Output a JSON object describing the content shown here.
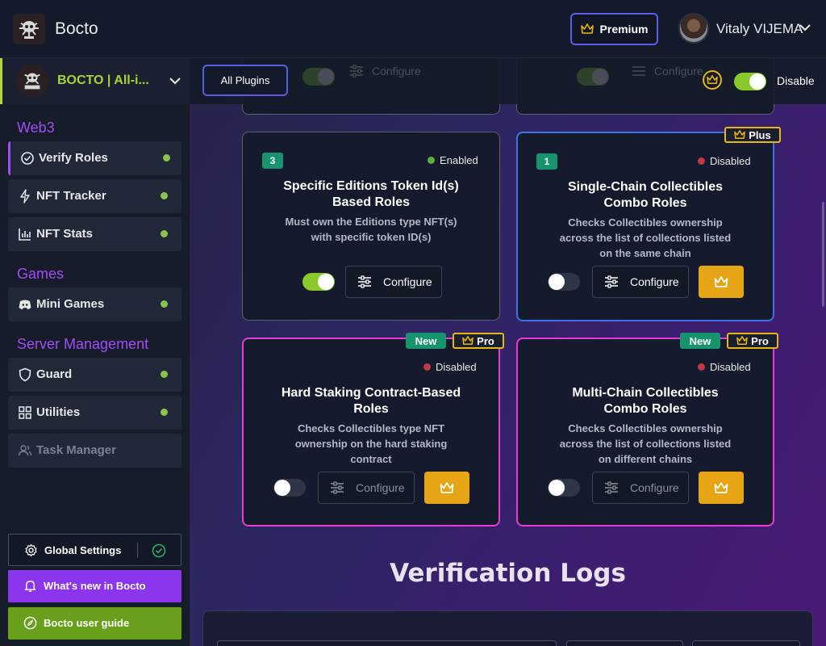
{
  "app": {
    "name": "Bocto"
  },
  "header": {
    "premium_label": "Premium",
    "user_name": "Vitaly VIJEMA"
  },
  "sidebar": {
    "server_name": "BOCTO | All-i...",
    "sections": {
      "web3": "Web3",
      "games": "Games",
      "server": "Server Management"
    },
    "items": [
      {
        "label": "Verify Roles",
        "icon": "check-circle-icon",
        "active": true
      },
      {
        "label": "NFT Tracker",
        "icon": "bolt-icon"
      },
      {
        "label": "NFT Stats",
        "icon": "bar-chart-icon"
      },
      {
        "label": "Mini Games",
        "icon": "discord-icon"
      },
      {
        "label": "Guard",
        "icon": "shield-icon"
      },
      {
        "label": "Utilities",
        "icon": "grid-icon"
      },
      {
        "label": "Task Manager",
        "icon": "users-icon",
        "disabled": true
      }
    ],
    "global_settings": "Global Settings",
    "whats_new": "What's new in Bocto",
    "guide": "Bocto user guide"
  },
  "toolbar": {
    "all_plugins": "All Plugins",
    "disable_label": "Disable",
    "top_configure": "Configure"
  },
  "cards": [
    {
      "count": "3",
      "status": "Enabled",
      "title_line1": "Specific Editions Token Id(s)",
      "title_line2": "Based Roles",
      "desc_line1": "Must own the Editions type NFT(s)",
      "desc_line2": "with specific token ID(s)",
      "configure": "Configure",
      "enabled": true
    },
    {
      "count": "1",
      "status": "Disabled",
      "plan": "Plus",
      "title_line1": "Single-Chain Collectibles",
      "title_line2": "Combo Roles",
      "desc_line1": "Checks Collectibles ownership",
      "desc_line2": "across the list of collections listed",
      "desc_line3": "on the same chain",
      "configure": "Configure"
    },
    {
      "status": "Disabled",
      "new_tag": "New",
      "plan": "Pro",
      "title_line1": "Hard Staking Contract-Based",
      "title_line2": "Roles",
      "desc_line1": "Checks Collectibles type NFT",
      "desc_line2": "ownership on the hard staking",
      "desc_line3": "contract",
      "configure": "Configure"
    },
    {
      "status": "Disabled",
      "new_tag": "New",
      "plan": "Pro",
      "title_line1": "Multi-Chain Collectibles",
      "title_line2": "Combo Roles",
      "desc_line1": "Checks Collectibles ownership",
      "desc_line2": "across the list of collections listed",
      "desc_line3": "on different chains",
      "configure": "Configure"
    }
  ],
  "logs": {
    "title": "Verification Logs"
  },
  "colors": {
    "accent_purple": "#a14df5",
    "accent_green": "#8bc82c",
    "gold": "#e6a514",
    "enabled": "#5fae3c",
    "disabled": "#c0394b"
  }
}
